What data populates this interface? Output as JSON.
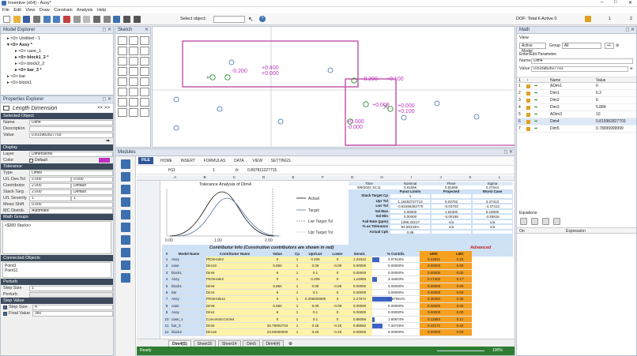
{
  "window": {
    "title": "Inventive (x64) - Assy*",
    "menu": [
      "File",
      "Edit",
      "View",
      "Draw",
      "Constrain",
      "Analysis",
      "Help"
    ]
  },
  "toolbar": {
    "select_label": "Select object:",
    "dof_text": "DOF: Total 6  Active 0",
    "page_num_a": "1",
    "page_num_b": "2"
  },
  "model_explorer": {
    "title": "Model Explorer",
    "items": [
      {
        "label": "<0> Untitled - 1",
        "indent": 1
      },
      {
        "label": "<0> Assy *",
        "indent": 1,
        "bold": true
      },
      {
        "label": "<0> case_1",
        "indent": 2
      },
      {
        "label": "<0> block1_2 *",
        "indent": 2,
        "bold": true
      },
      {
        "label": "<0> block2_2",
        "indent": 2
      },
      {
        "label": "<0> bar_3 *",
        "indent": 2,
        "bold": true
      },
      {
        "label": "<0> bar",
        "indent": 1
      },
      {
        "label": "<0> block1",
        "indent": 1
      }
    ]
  },
  "sketch": {
    "title": "Sketch"
  },
  "canvas": {
    "labels": [
      "-0.200",
      "+0.400",
      "+0.000",
      "-0.200",
      "+0.100",
      "+0.000",
      "+0.100",
      "+0.000",
      "-0.000",
      "+0.000"
    ]
  },
  "properties": {
    "title": "Properties Explorer",
    "heading": "Length Dimension",
    "selected_object": "Selected Object",
    "name_label": "Name",
    "name_value": "Dim4",
    "desc_label": "Description",
    "desc_value": "",
    "value_label": "Value",
    "value_value": "0.815982827703",
    "display": "Display",
    "layer_label": "Layer",
    "layer_value": "Dimensions",
    "color_label": "Color",
    "color_value": "Default",
    "tolerance": "Tolerance",
    "type_label": "Type",
    "type_value": "Limits",
    "ul_label": "U/L Dev.Tol",
    "u_value": "2.000",
    "l_value": "0.000",
    "contrib_label": "Contributor",
    "contrib_value": "2.000",
    "contrib_opt": "Default",
    "stack_label": "Stack Targ",
    "stack_value": "2.000",
    "stack_opt": "Default",
    "sev_label": "U/L Severity",
    "sev_u": "1",
    "sev_l": "1",
    "mean_label": "Mean Shift",
    "mean_value": "0.000",
    "mcd_label": "MC Distrib.",
    "mcd_value": "Automatic",
    "math_groups": "Math Groups",
    "math_item": "<$300 Stacks>",
    "connected": "Connected Objects",
    "conn_items": [
      "Point3",
      "Point11"
    ],
    "perturb": "Perturb",
    "step_label": "Step Size",
    "step_value": "1",
    "perturb_label": "Perturb",
    "step_value_hdr": "Step Value",
    "stepsize_chk": "Step Size",
    "stepsize_v": "4",
    "final_chk": "Final Value",
    "final_v": "360"
  },
  "modules": {
    "title": "Modules",
    "ribbon": [
      "FILE",
      "HOME",
      "INSERT",
      "FORMULAS",
      "DATA",
      "VIEW",
      "SETTINGS"
    ],
    "cell_ref": "H11",
    "cell_num": "1",
    "formula": "0.897811227715",
    "col_headers": [
      "A",
      "B",
      "C",
      "D",
      "E",
      "F",
      "G",
      "H",
      "I",
      "J",
      "K",
      "L"
    ],
    "chart_title": "Tolerance Analysis of Dim4",
    "legend": [
      "Actual",
      "Target",
      "Lwr Target Tol",
      "Upr Target Tol"
    ],
    "x_ticks": [
      "0.00",
      "1.00",
      "2.00"
    ],
    "summary_headers": [
      "Time",
      "Nominal",
      "Flexe",
      "Sigma"
    ],
    "summary_values": [
      "8/9/2022 10:11",
      "0.81596",
      "0.81596",
      "0.27044"
    ],
    "info_headers": [
      "Funct Limits",
      "Projected",
      "Worst Case"
    ],
    "info_rows": [
      {
        "label": "Stack Target Cp",
        "a": "1",
        "b": "",
        "c": ""
      },
      {
        "label": "Upr Tol",
        "a": "1.18483727713",
        "b": "0.03702",
        "c": "4.37413"
      },
      {
        "label": "Lwr Tol",
        "a": "-0.81596282770",
        "b": "-0.03702",
        "c": "-4.37413"
      },
      {
        "label": "Val Max",
        "a": "2.00000",
        "b": "1.62300",
        "c": "5.18000"
      },
      {
        "label": "Val Min",
        "a": "0.00000",
        "b": "-0.00195",
        "c": "-3.55816"
      },
      {
        "label": "Fail Rate (ppm)",
        "a": "1399.33217",
        "b": "n/a",
        "c": "n/a"
      },
      {
        "label": "% as Tolerance",
        "a": "94.98133%",
        "b": "n/a",
        "c": "n/a"
      },
      {
        "label": "Actual Cpk",
        "a": "0.88",
        "b": "",
        "c": ""
      }
    ],
    "contrib_title": "Contributor Info (Constrution contributors are shown in red)",
    "advanced": "Advanced",
    "table_headers": [
      "#",
      "Model Name",
      "Contributor Name",
      "Value",
      "Cp",
      "Upr/Lwr",
      "Lower",
      "Sensit.",
      "% Contrib.",
      "UMC",
      "LMC"
    ],
    "rows": [
      [
        "1",
        "Assy",
        "PtOnHole2",
        "0",
        "1",
        "0.206",
        "0",
        "1.34022",
        "4.97518%",
        "0.23831",
        "0.23"
      ],
      [
        "2",
        "case",
        "Dim10",
        "5.884",
        "1",
        "0.09",
        "-0.09",
        "0.00000",
        "0.00000%",
        "0.00000",
        "0.00"
      ],
      [
        "3",
        "block1",
        "Dim5",
        "6",
        "1",
        "0.1",
        "0",
        "0.00000",
        "0.00000%",
        "0.00000",
        "0.00"
      ],
      [
        "4",
        "Assy",
        "PtOnHole2",
        "0",
        "1",
        "0.206",
        "0",
        "1.24866",
        "3.44603%",
        "0.17402",
        "0.17"
      ],
      [
        "5",
        "block1",
        "Dim6",
        "5.884",
        "1",
        "0.09",
        "-0.09",
        "0.00000",
        "0.00000%",
        "0.00000",
        "0.00"
      ],
      [
        "6",
        "bar",
        "Dim4",
        "6",
        "1",
        "0.1",
        "0",
        "0.00000",
        "0.00000%",
        "0.00000",
        "0.00"
      ],
      [
        "7",
        "Assy",
        "PtOnHole11",
        "0",
        "1",
        "0.206000000",
        "0",
        "2.27872",
        "13.67951%",
        "0.36394",
        "0.36"
      ],
      [
        "8",
        "case",
        "Dim9",
        "5.884",
        "1",
        "0.09",
        "-0.09",
        "0.00000",
        "0.00000%",
        "0.00000",
        "0.00"
      ],
      [
        "9",
        "Assy",
        "Dim2",
        "6",
        "1",
        "0.1",
        "0",
        "0.00000",
        "0.00000%",
        "0.00000",
        "0.00"
      ],
      [
        "10",
        "case_1",
        "ConcentricCircle4",
        "0",
        "1",
        "0.1",
        "0",
        "0.86066",
        "1.60874%",
        "0.11884",
        "0.11"
      ],
      [
        "11",
        "bar_3",
        "Dim5",
        "26.79003734",
        "1",
        "0.25",
        "-0.25",
        "0.88682",
        "7.34745%",
        "0.22171",
        "0.22"
      ],
      [
        "12",
        "block2",
        "Dim16",
        "23.50000000",
        "1",
        "0.25",
        "-0.25",
        "0.00000",
        "0.00000%",
        "0.00000",
        "0.00"
      ]
    ],
    "sheet_tabs": [
      "Dim4(S)",
      "Sheet15",
      "Sheet14",
      "Dim5",
      "Dim4(4)"
    ],
    "status": "Ready",
    "zoom": "100%"
  },
  "math": {
    "title": "Math",
    "view": "View",
    "active_model": "Active Model",
    "group_label": "Group",
    "group_value": "All",
    "enter_param": "Enter/Edit Parameter:",
    "name_label": "Name",
    "name_value": "Dim4",
    "value_label": "Value",
    "value_value": "0.815982827703",
    "col_name": "Name",
    "col_value": "Value",
    "rows": [
      {
        "n": "1",
        "name": "ADim1",
        "value": "0"
      },
      {
        "n": "2",
        "name": "Dim1",
        "value": "6.2"
      },
      {
        "n": "3",
        "name": "Dim2",
        "value": "6"
      },
      {
        "n": "4",
        "name": "Dim3",
        "value": "5.884"
      },
      {
        "n": "5",
        "name": "ADim3",
        "value": "10"
      },
      {
        "n": "6",
        "name": "Dim4",
        "value": "0.815982827703"
      },
      {
        "n": "7",
        "name": "Dim5",
        "value": "0.78999999999"
      }
    ],
    "equations": "Equations:",
    "on_label": "On",
    "expr_label": "Expression"
  },
  "colors": {
    "accent": "#3b6fb0",
    "sketch_line": "#c050a8",
    "blue_fill": "#cfe1f5",
    "yellow_fill": "#fff3a8",
    "orange_fill": "#f6a020",
    "bar_blue": "#2a52be"
  }
}
